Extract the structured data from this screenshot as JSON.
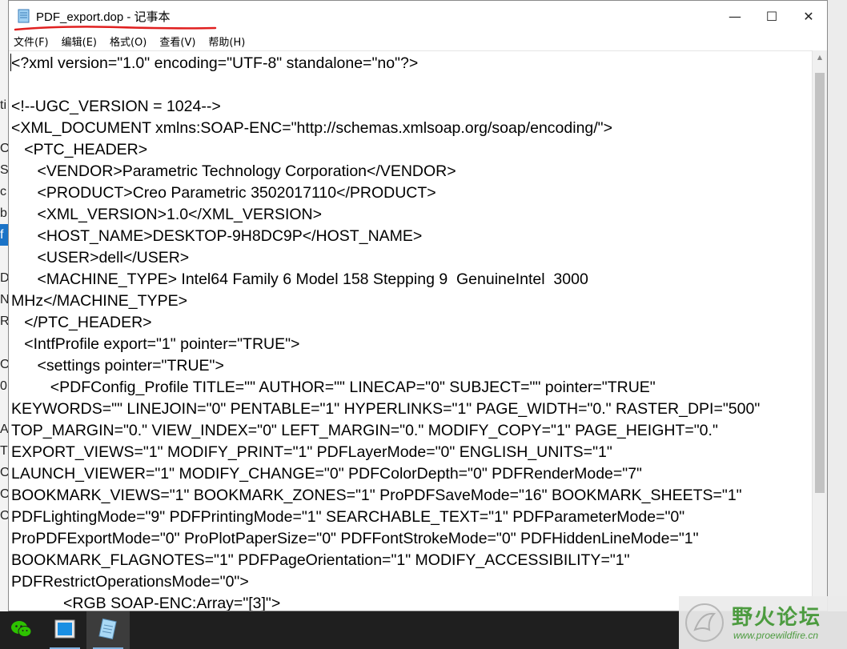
{
  "window": {
    "title": "PDF_export.dop - 记事本",
    "minimize_glyph": "—",
    "maximize_glyph": "☐",
    "close_glyph": "✕",
    "annotation_color": "#e02020"
  },
  "menu": [
    {
      "label": "文件(F)"
    },
    {
      "label": "编辑(E)"
    },
    {
      "label": "格式(O)"
    },
    {
      "label": "查看(V)"
    },
    {
      "label": "帮助(H)"
    }
  ],
  "editor": {
    "text": "<?xml version=\"1.0\" encoding=\"UTF-8\" standalone=\"no\"?>\n\n<!--UGC_VERSION = 1024-->\n<XML_DOCUMENT xmlns:SOAP-ENC=\"http://schemas.xmlsoap.org/soap/encoding/\">\n   <PTC_HEADER>\n      <VENDOR>Parametric Technology Corporation</VENDOR>\n      <PRODUCT>Creo Parametric 3502017110</PRODUCT>\n      <XML_VERSION>1.0</XML_VERSION>\n      <HOST_NAME>DESKTOP-9H8DC9P</HOST_NAME>\n      <USER>dell</USER>\n      <MACHINE_TYPE> Intel64 Family 6 Model 158 Stepping 9  GenuineIntel  3000\nMHz</MACHINE_TYPE>\n   </PTC_HEADER>\n   <IntfProfile export=\"1\" pointer=\"TRUE\">\n      <settings pointer=\"TRUE\">\n         <PDFConfig_Profile TITLE=\"\" AUTHOR=\"\" LINECAP=\"0\" SUBJECT=\"\" pointer=\"TRUE\"\nKEYWORDS=\"\" LINEJOIN=\"0\" PENTABLE=\"1\" HYPERLINKS=\"1\" PAGE_WIDTH=\"0.\" RASTER_DPI=\"500\"\nTOP_MARGIN=\"0.\" VIEW_INDEX=\"0\" LEFT_MARGIN=\"0.\" MODIFY_COPY=\"1\" PAGE_HEIGHT=\"0.\"\nEXPORT_VIEWS=\"1\" MODIFY_PRINT=\"1\" PDFLayerMode=\"0\" ENGLISH_UNITS=\"1\"\nLAUNCH_VIEWER=\"1\" MODIFY_CHANGE=\"0\" PDFColorDepth=\"0\" PDFRenderMode=\"7\"\nBOOKMARK_VIEWS=\"1\" BOOKMARK_ZONES=\"1\" ProPDFSaveMode=\"16\" BOOKMARK_SHEETS=\"1\"\nPDFLightingMode=\"9\" PDFPrintingMode=\"1\" SEARCHABLE_TEXT=\"1\" PDFParameterMode=\"0\"\nProPDFExportMode=\"0\" ProPlotPaperSize=\"0\" PDFFontStrokeMode=\"0\" PDFHiddenLineMode=\"1\"\nBOOKMARK_FLAGNOTES=\"1\" PDFPageOrientation=\"1\" MODIFY_ACCESSIBILITY=\"1\"\nPDFRestrictOperationsMode=\"0\">\n            <RGB SOAP-ENC:Array=\"[3]\">"
  },
  "background_left_letters": "ti\n\nO\nS\nc\nb\nf\n\nD\nN\nR\n\nO\n0\n\nA\nT\nO\nO\nO",
  "watermark": {
    "title": "野火论坛",
    "url": "www.proewildfire.cn"
  }
}
